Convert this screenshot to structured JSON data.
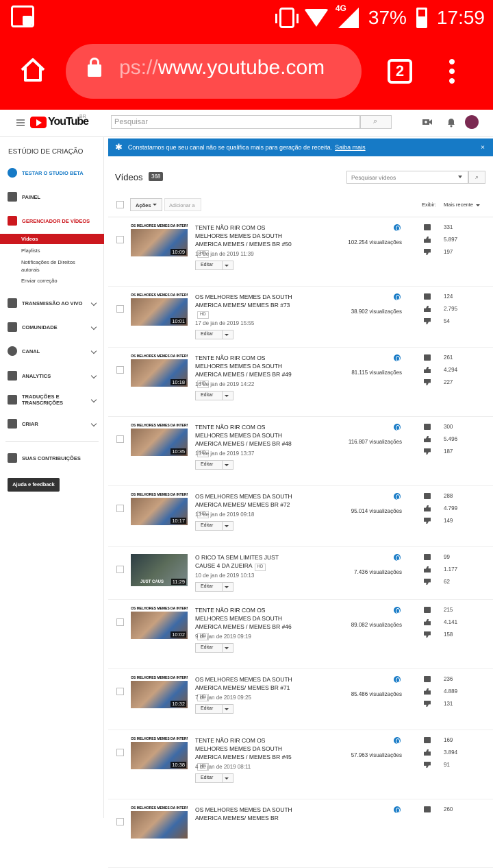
{
  "statusbar": {
    "battery": "37%",
    "time": "17:59",
    "network": "4G"
  },
  "browser": {
    "url_prefix": "ps://",
    "url_domain": "www.youtube.com",
    "tab_count": "2"
  },
  "youtube": {
    "logo": "YouTube",
    "region": "BR",
    "search_placeholder": "Pesquisar"
  },
  "sidebar": {
    "title": "ESTÚDIO DE CRIAÇÃO",
    "items": [
      {
        "label": "TESTAR O STUDIO BETA"
      },
      {
        "label": "PAINEL"
      },
      {
        "label": "GERENCIADOR DE VÍDEOS"
      },
      {
        "label": "TRANSMISSÃO AO VIVO"
      },
      {
        "label": "COMUNIDADE"
      },
      {
        "label": "CANAL"
      },
      {
        "label": "ANALYTICS"
      },
      {
        "label": "TRADUÇÕES E TRANSCRIÇÕES"
      },
      {
        "label": "CRIAR"
      },
      {
        "label": "SUAS CONTRIBUIÇÕES"
      }
    ],
    "sub_items": [
      "Vídeos",
      "Playlists",
      "Notificações de Direitos autorais",
      "Enviar correção"
    ],
    "feedback": "Ajuda e feedback"
  },
  "banner": {
    "text": "Constatamos que seu canal não se qualifica mais para geração de receita.",
    "link": "Saiba mais",
    "close": "×"
  },
  "videos_header": {
    "title": "Vídeos",
    "count": "368",
    "search_placeholder": "Pesquisar vídeos",
    "actions": "Ações",
    "add_to": "Adicionar a",
    "display": "Exibir:",
    "sort": "Mais recente"
  },
  "thumb_caption": "OS MELHORES MEMES DA INTERNET",
  "thumb_caption_alt": "JUST CAUS",
  "edit_label": "Editar",
  "hd_label": "HD",
  "videos": [
    {
      "title": "TENTE NÃO RIR COM OS MELHORES MEMES DA SOUTH AMERICA MEMES / MEMES BR #50",
      "hd": true,
      "date": "18 de jan de 2019 11:39",
      "views": "102.254 visualizações",
      "comments": "331",
      "likes": "5.897",
      "dislikes": "197",
      "duration": "10:09"
    },
    {
      "title": "OS MELHORES MEMES DA SOUTH AMERICA MEMES/ MEMES BR #73",
      "hd": true,
      "date": "17 de jan de 2019 15:55",
      "views": "38.902 visualizações",
      "comments": "124",
      "likes": "2.795",
      "dislikes": "54",
      "duration": "10:01"
    },
    {
      "title": "TENTE NÃO RIR COM OS MELHORES MEMES DA SOUTH AMERICA MEMES / MEMES BR #49",
      "hd": true,
      "date": "16 de jan de 2019 14:22",
      "views": "81.115 visualizações",
      "comments": "261",
      "likes": "4.294",
      "dislikes": "227",
      "duration": "10:18"
    },
    {
      "title": "TENTE NÃO RIR COM OS MELHORES MEMES DA SOUTH AMERICA MEMES / MEMES BR #48",
      "hd": true,
      "date": "15 de jan de 2019 13:37",
      "views": "116.807 visualizações",
      "comments": "300",
      "likes": "5.496",
      "dislikes": "187",
      "duration": "10:35"
    },
    {
      "title": "OS MELHORES MEMES DA SOUTH AMERICA MEMES/ MEMES BR #72",
      "hd": true,
      "date": "13 de jan de 2019 09:18",
      "views": "95.014 visualizações",
      "comments": "288",
      "likes": "4.799",
      "dislikes": "149",
      "duration": "10:17"
    },
    {
      "title": "O RICO TA SEM LIMITES JUST CAUSE 4 DA ZUEIRA",
      "hd": true,
      "date": "10 de jan de 2019 10:13",
      "views": "7.436 visualizações",
      "comments": "99",
      "likes": "1.177",
      "dislikes": "62",
      "duration": "11:29"
    },
    {
      "title": "TENTE NÃO RIR COM OS MELHORES MEMES DA SOUTH AMERICA MEMES / MEMES BR #46",
      "hd": true,
      "date": "9 de jan de 2019 09:19",
      "views": "89.082 visualizações",
      "comments": "215",
      "likes": "4.141",
      "dislikes": "158",
      "duration": "10:02"
    },
    {
      "title": "OS MELHORES MEMES DA SOUTH AMERICA MEMES/ MEMES BR #71",
      "hd": true,
      "date": "7 de jan de 2019 09:25",
      "views": "85.486 visualizações",
      "comments": "236",
      "likes": "4.889",
      "dislikes": "131",
      "duration": "10:32"
    },
    {
      "title": "TENTE NÃO RIR COM OS MELHORES MEMES DA SOUTH AMERICA MEMES / MEMES BR #45",
      "hd": true,
      "date": "4 de jan de 2019 08:11",
      "views": "57.963 visualizações",
      "comments": "169",
      "likes": "3.894",
      "dislikes": "91",
      "duration": "10:38"
    },
    {
      "title": "OS MELHORES MEMES DA SOUTH AMERICA MEMES/ MEMES BR",
      "hd": false,
      "date": "",
      "views": "",
      "comments": "260",
      "likes": "",
      "dislikes": "",
      "duration": ""
    }
  ]
}
